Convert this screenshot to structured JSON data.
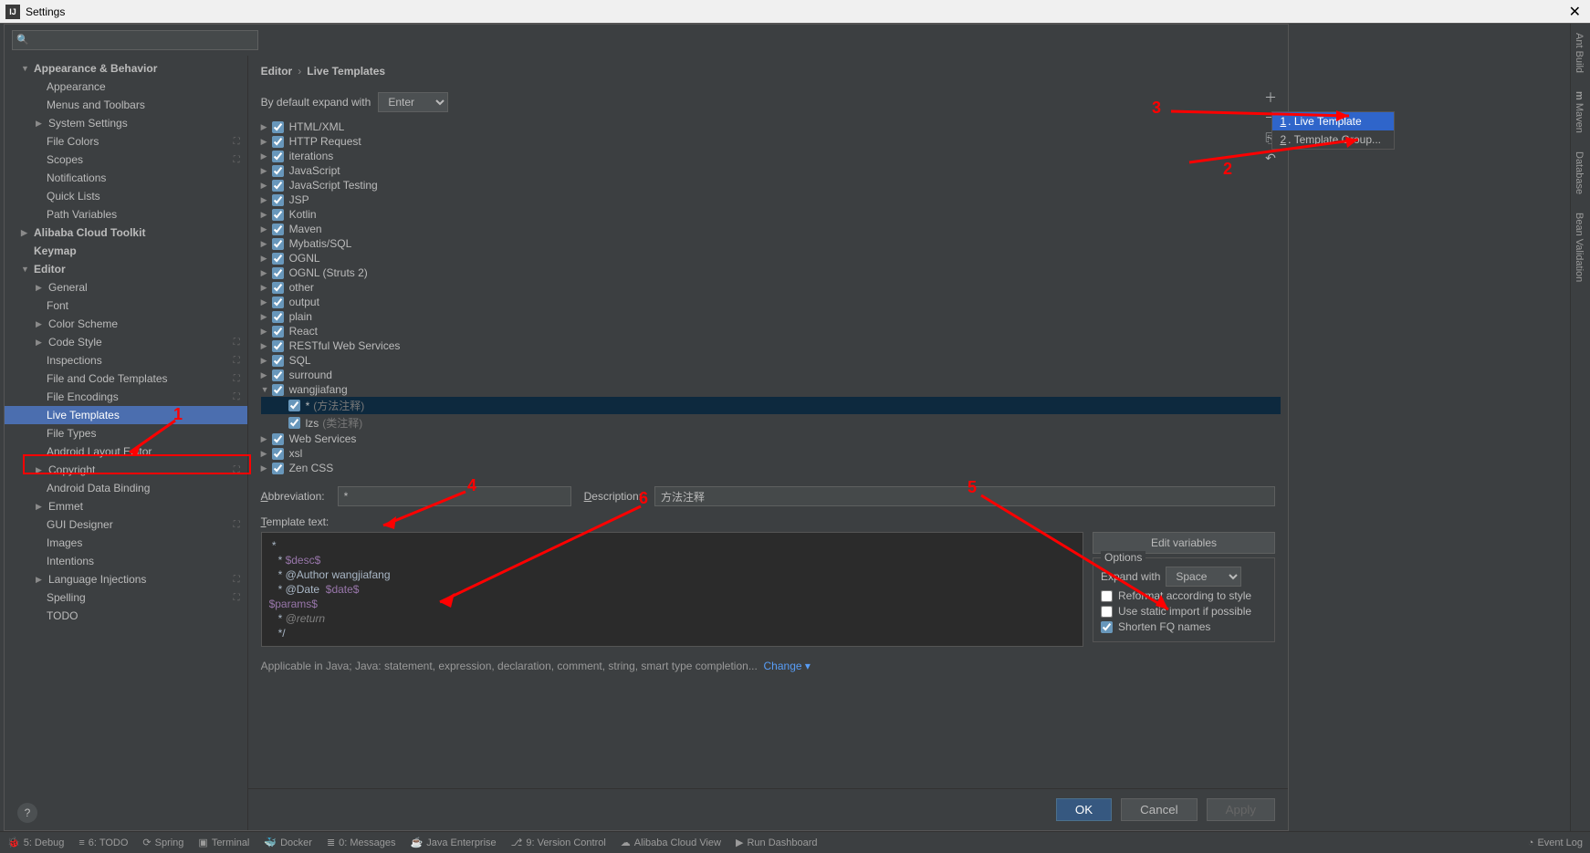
{
  "window": {
    "title": "Settings"
  },
  "search": {
    "placeholder": ""
  },
  "sidebar": {
    "appearance_behavior": "Appearance & Behavior",
    "appearance": "Appearance",
    "menus_toolbars": "Menus and Toolbars",
    "system_settings": "System Settings",
    "file_colors": "File Colors",
    "scopes": "Scopes",
    "notifications": "Notifications",
    "quick_lists": "Quick Lists",
    "path_variables": "Path Variables",
    "alibaba": "Alibaba Cloud Toolkit",
    "keymap": "Keymap",
    "editor": "Editor",
    "general": "General",
    "font": "Font",
    "color_scheme": "Color Scheme",
    "code_style": "Code Style",
    "inspections": "Inspections",
    "file_code_templates": "File and Code Templates",
    "file_encodings": "File Encodings",
    "live_templates": "Live Templates",
    "file_types": "File Types",
    "android_layout": "Android Layout Editor",
    "copyright": "Copyright",
    "android_data": "Android Data Binding",
    "emmet": "Emmet",
    "gui_designer": "GUI Designer",
    "images": "Images",
    "intentions": "Intentions",
    "lang_injections": "Language Injections",
    "spelling": "Spelling",
    "todo": "TODO"
  },
  "breadcrumb": {
    "a": "Editor",
    "b": "Live Templates"
  },
  "expand": {
    "label": "By default expand with",
    "value": "Enter"
  },
  "groups": [
    {
      "name": "HTML/XML"
    },
    {
      "name": "HTTP Request"
    },
    {
      "name": "iterations"
    },
    {
      "name": "JavaScript"
    },
    {
      "name": "JavaScript Testing"
    },
    {
      "name": "JSP"
    },
    {
      "name": "Kotlin"
    },
    {
      "name": "Maven"
    },
    {
      "name": "Mybatis/SQL"
    },
    {
      "name": "OGNL"
    },
    {
      "name": "OGNL (Struts 2)"
    },
    {
      "name": "other"
    },
    {
      "name": "output"
    },
    {
      "name": "plain"
    },
    {
      "name": "React"
    },
    {
      "name": "RESTful Web Services"
    },
    {
      "name": "SQL"
    },
    {
      "name": "surround"
    }
  ],
  "expanded_group": {
    "name": "wangjiafang",
    "items": [
      {
        "abbr": "*",
        "desc": "(方法注释)",
        "selected": true
      },
      {
        "abbr": "lzs",
        "desc": "(类注释)"
      }
    ]
  },
  "groups_after": [
    {
      "name": "Web Services"
    },
    {
      "name": "xsl"
    },
    {
      "name": "Zen CSS"
    }
  ],
  "form": {
    "abbrev_label": "Abbreviation:",
    "abbrev_value": "*",
    "desc_label": "Description:",
    "desc_value": "方法注释",
    "tt_label": "Template text:",
    "edit_vars": "Edit variables",
    "options_title": "Options",
    "expand_with": "Expand with",
    "expand_with_value": "Space",
    "reformat": "Reformat according to style",
    "static_import": "Use static import if possible",
    "shorten": "Shorten FQ names"
  },
  "template_lines": {
    "l1": " *",
    "l2_a": "   * ",
    "l2_b": "$desc$",
    "l3": "   * @Author wangjiafang",
    "l4_a": "   * @Date  ",
    "l4_b": "$date$",
    "l5": "$params$",
    "l6_a": "   * ",
    "l6_b": "@return",
    "l7": "   */"
  },
  "applicable": {
    "text": "Applicable in Java; Java: statement, expression, declaration, comment, string, smart type completion...",
    "change": "Change"
  },
  "buttons": {
    "ok": "OK",
    "cancel": "Cancel",
    "apply": "Apply"
  },
  "popup": {
    "item1": "Live Template",
    "item2": "Template Group..."
  },
  "rightbar": {
    "ant": "Ant Build",
    "maven": "Maven",
    "database": "Database",
    "bean": "Bean Validation"
  },
  "statusbar": {
    "debug": "5: Debug",
    "todo": "6: TODO",
    "spring": "Spring",
    "terminal": "Terminal",
    "docker": "Docker",
    "messages": "0: Messages",
    "java": "Java Enterprise",
    "vcs": "9: Version Control",
    "alibaba": "Alibaba Cloud View",
    "run": "Run Dashboard",
    "event": "Event Log"
  },
  "annotations": {
    "n1": "1",
    "n2": "2",
    "n3": "3",
    "n4": "4",
    "n5": "5",
    "n6": "6"
  }
}
